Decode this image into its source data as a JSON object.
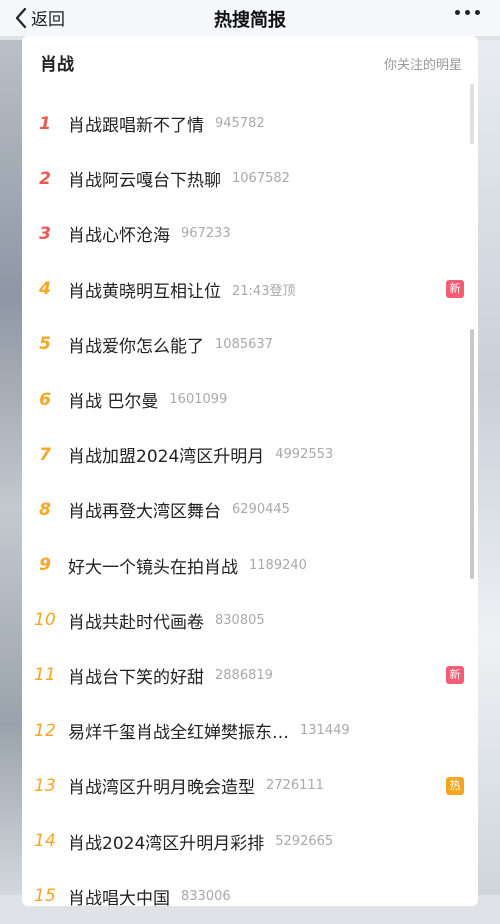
{
  "header": {
    "back_label": "返回",
    "title": "热搜简报"
  },
  "card": {
    "heading": "肖战",
    "subtitle": "你关注的明星"
  },
  "items": [
    {
      "rank": "1",
      "text": "肖战跟唱新不了情",
      "count": "945782",
      "badge": ""
    },
    {
      "rank": "2",
      "text": "肖战阿云嘎台下热聊",
      "count": "1067582",
      "badge": ""
    },
    {
      "rank": "3",
      "text": "肖战心怀沧海",
      "count": "967233",
      "badge": ""
    },
    {
      "rank": "4",
      "text": "肖战黄晓明互相让位",
      "count": "21:43登顶",
      "badge": "新"
    },
    {
      "rank": "5",
      "text": "肖战爱你怎么能了",
      "count": "1085637",
      "badge": ""
    },
    {
      "rank": "6",
      "text": "肖战 巴尔曼",
      "count": "1601099",
      "badge": ""
    },
    {
      "rank": "7",
      "text": "肖战加盟2024湾区升明月",
      "count": "4992553",
      "badge": ""
    },
    {
      "rank": "8",
      "text": "肖战再登大湾区舞台",
      "count": "6290445",
      "badge": ""
    },
    {
      "rank": "9",
      "text": "好大一个镜头在拍肖战",
      "count": "1189240",
      "badge": ""
    },
    {
      "rank": "10",
      "text": "肖战共赴时代画卷",
      "count": "830805",
      "badge": ""
    },
    {
      "rank": "11",
      "text": "肖战台下笑的好甜",
      "count": "2886819",
      "badge": "新"
    },
    {
      "rank": "12",
      "text": "易烊千玺肖战全红婵樊振东…",
      "count": "131449",
      "badge": ""
    },
    {
      "rank": "13",
      "text": "肖战湾区升明月晚会造型",
      "count": "2726111",
      "badge": "热"
    },
    {
      "rank": "14",
      "text": "肖战2024湾区升明月彩排",
      "count": "5292665",
      "badge": ""
    },
    {
      "rank": "15",
      "text": "肖战唱大中国",
      "count": "833006",
      "badge": ""
    }
  ],
  "colors": {
    "rank_top": "#f0584f",
    "rank_other": "#f5a623",
    "badge_new": "#f45d74",
    "badge_hot": "#f7a51d"
  },
  "icons": {
    "back": "chevron-left-icon",
    "more": "more-dots-icon"
  }
}
